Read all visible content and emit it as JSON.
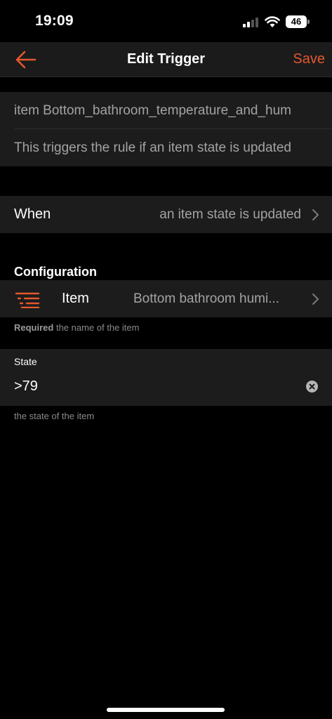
{
  "status_bar": {
    "time": "19:09",
    "battery": "46"
  },
  "nav": {
    "title": "Edit Trigger",
    "save_label": "Save",
    "accent_color": "#e4572e"
  },
  "trigger": {
    "name": "item Bottom_bathroom_temperature_and_hum",
    "description": "This triggers the rule if an item state is updated"
  },
  "when": {
    "label": "When",
    "value": "an item state is updated"
  },
  "configuration": {
    "heading": "Configuration",
    "item": {
      "label": "Item",
      "value": "Bottom bathroom humi...",
      "icon": "list-icon",
      "helper_required": "Required",
      "helper_text": "the name of the item"
    },
    "state": {
      "label": "State",
      "value": ">79",
      "helper_text": "the state of the item"
    }
  }
}
